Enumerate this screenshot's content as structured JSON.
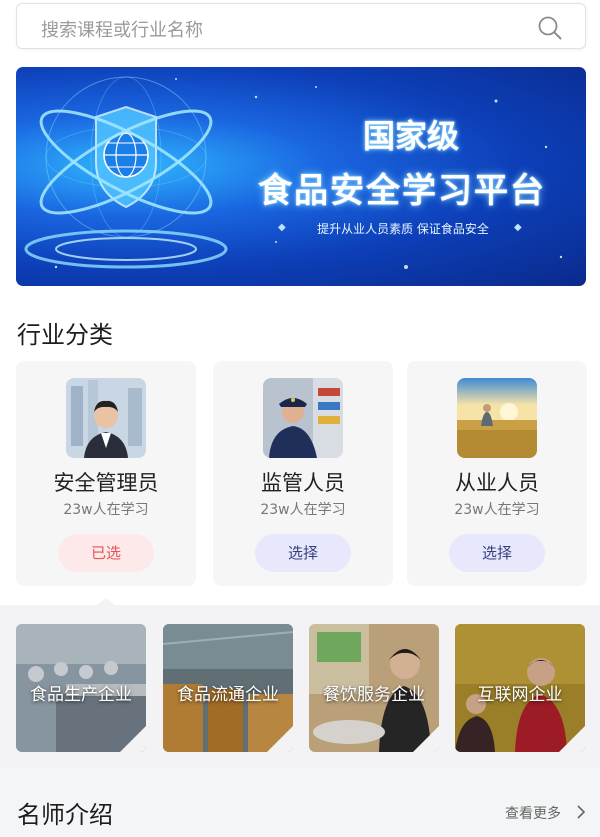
{
  "search": {
    "placeholder": "搜索课程或行业名称",
    "icon": "search-icon"
  },
  "banner": {
    "title_line1": "国家级",
    "title_line2": "食品安全学习平台",
    "slogan": "提升从业人员素质  保证食品安全",
    "colors": {
      "bg_dark": "#0a2a8c",
      "bg_light": "#2fb6ff"
    }
  },
  "industry": {
    "title": "行业分类",
    "cards": [
      {
        "name": "安全管理员",
        "count": "23w人在学习",
        "button": "已选",
        "selected": true
      },
      {
        "name": "监管人员",
        "count": "23w人在学习",
        "button": "选择",
        "selected": false
      },
      {
        "name": "从业人员",
        "count": "23w人在学习",
        "button": "选择",
        "selected": false
      }
    ],
    "subcategories": [
      "食品生产企业",
      "食品流通企业",
      "餐饮服务企业",
      "互联网企业"
    ]
  },
  "teachers": {
    "title": "名师介绍",
    "more": "查看更多"
  },
  "colors": {
    "selected_text": "#e55454",
    "selected_bg": "#fde9e9",
    "button_text": "#39407f",
    "button_bg": "#e7e8fb"
  }
}
